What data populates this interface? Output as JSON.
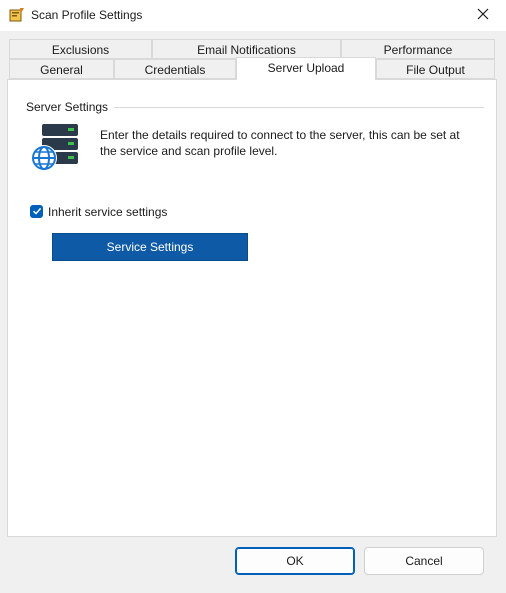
{
  "window": {
    "title": "Scan Profile Settings"
  },
  "icons": {
    "app": "scan-profile-icon",
    "close": "close-icon",
    "server": "server-globe-icon",
    "check": "checkmark-icon"
  },
  "tabs_row1": [
    {
      "label": "Exclusions"
    },
    {
      "label": "Email Notifications"
    },
    {
      "label": "Performance"
    }
  ],
  "tabs_row2": [
    {
      "label": "General"
    },
    {
      "label": "Credentials"
    },
    {
      "label": "Server Upload",
      "active": true
    },
    {
      "label": "File Output"
    }
  ],
  "server_settings": {
    "group_title": "Server Settings",
    "description": "Enter the details required to connect to the server, this can be set at the service and scan profile level.",
    "inherit_label": "Inherit service settings",
    "inherit_checked": true,
    "service_button_label": "Service Settings"
  },
  "footer": {
    "ok_label": "OK",
    "cancel_label": "Cancel"
  },
  "colors": {
    "accent": "#005fb8",
    "service_button": "#0f5aa6",
    "server_led": "#3cc24a"
  }
}
